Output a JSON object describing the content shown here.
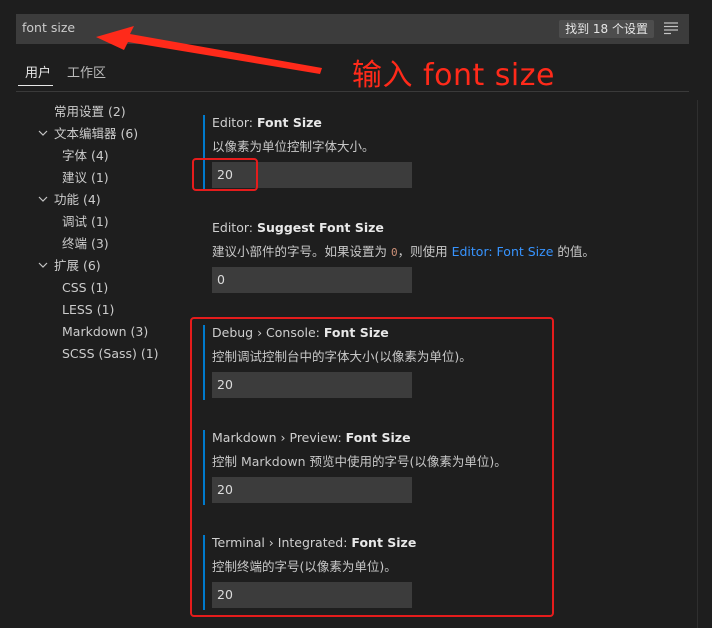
{
  "search": {
    "value": "font size",
    "result_count": "找到 18 个设置"
  },
  "annotation": {
    "text": "输入  font size",
    "color": "#ff2a1a"
  },
  "tabs": [
    {
      "label": "用户",
      "active": true
    },
    {
      "label": "工作区",
      "active": false
    }
  ],
  "toc": [
    {
      "label": "常用设置 (2)",
      "chevron": "none"
    },
    {
      "label": "文本编辑器 (6)",
      "chevron": "down"
    },
    {
      "label": "字体 (4)",
      "chevron": "none"
    },
    {
      "label": "建议 (1)",
      "chevron": "none"
    },
    {
      "label": "功能 (4)",
      "chevron": "down"
    },
    {
      "label": "调试 (1)",
      "chevron": "none"
    },
    {
      "label": "终端 (3)",
      "chevron": "none"
    },
    {
      "label": "扩展 (6)",
      "chevron": "down"
    },
    {
      "label": "CSS (1)",
      "chevron": "none"
    },
    {
      "label": "LESS (1)",
      "chevron": "none"
    },
    {
      "label": "Markdown (3)",
      "chevron": "none"
    },
    {
      "label": "SCSS (Sass) (1)",
      "chevron": "none"
    }
  ],
  "settings": [
    {
      "category": "Editor: ",
      "name": "Font Size",
      "description": "以像素为单位控制字体大小。",
      "value": "20"
    },
    {
      "category": "Editor: ",
      "name": "Suggest Font Size",
      "description_pre": "建议小部件的字号。如果设置为 ",
      "description_code": "0",
      "description_mid": "，则使用 ",
      "description_link": "Editor: Font Size",
      "description_post": " 的值。",
      "value": "0"
    },
    {
      "category": "Debug › Console: ",
      "name": "Font Size",
      "description": "控制调试控制台中的字体大小(以像素为单位)。",
      "value": "20"
    },
    {
      "category": "Markdown › Preview: ",
      "name": "Font Size",
      "description": "控制 Markdown 预览中使用的字号(以像素为单位)。",
      "value": "20"
    },
    {
      "category": "Terminal › Integrated: ",
      "name": "Font Size",
      "description": "控制终端的字号(以像素为单位)。",
      "value": "20"
    }
  ],
  "colors": {
    "accent": "#007acc",
    "highlight_box": "#e51c1c",
    "link": "#3794ff"
  }
}
